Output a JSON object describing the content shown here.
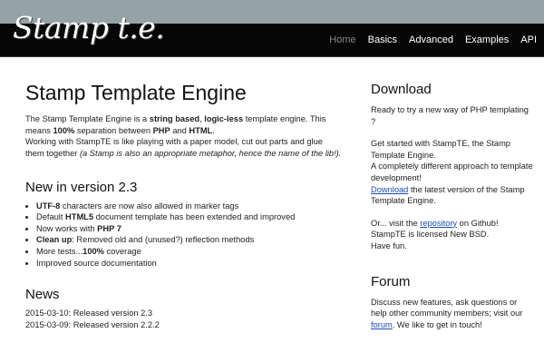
{
  "header": {
    "logo": "Stamp t.e.",
    "nav": [
      "Home",
      "Basics",
      "Advanced",
      "Examples",
      "API"
    ]
  },
  "main": {
    "title": "Stamp Template Engine",
    "intro": {
      "t1": "The Stamp Template Engine is a ",
      "b1": "string based",
      "t2": ", ",
      "b2": "logic-less",
      "t3": " template engine. This means ",
      "b3": "100%",
      "t4": " separation between ",
      "b4": "PHP",
      "t5": " and ",
      "b5": "HTML",
      "t6": ".",
      "t7": "Working with StampTE is like playing with a paper model, cut out parts and glue them together ",
      "i1": "(a Stamp is also an appropriate metaphor, hence the name of the lib!)."
    },
    "new": {
      "title": "New in version 2.3",
      "items": [
        {
          "pre": "",
          "bold": "UTF-8",
          "post": " characters are now also allowed in marker tags"
        },
        {
          "pre": "Default ",
          "bold": "HTML5",
          "post": " document template has been extended and improved"
        },
        {
          "pre": "Now works with ",
          "bold": "PHP 7",
          "post": ""
        },
        {
          "pre": "",
          "bold": "Clean up",
          "post": ": Removed old and (unused?) reflection methods"
        },
        {
          "pre": "More tests...",
          "bold": "100%",
          "post": " coverage"
        },
        {
          "pre": "Improved source documentation",
          "bold": "",
          "post": ""
        }
      ]
    },
    "news": {
      "title": "News",
      "items": [
        "2015-03-10: Released version 2.3",
        "2015-03-09: Released version 2.2.2"
      ]
    }
  },
  "sidebar": {
    "download": {
      "title": "Download",
      "p1": "Ready to try a new way of PHP templating ?",
      "p2": "Get started with StampTE, the Stamp Template Engine.",
      "p3": "A completely different approach to template development!",
      "p4_link": "Download",
      "p4_rest": " the latest version of the Stamp Template Engine.",
      "p5_a": "Or... visit the ",
      "p5_link": "repository",
      "p5_b": " on Github!",
      "p6": "StampTE is licensed New BSD.",
      "p7": "Have fun."
    },
    "forum": {
      "title": "Forum",
      "p_a": "Discuss new features, ask questions or help other community members; visit our ",
      "link": "forum",
      "p_b": ". We like to get in touch!"
    }
  }
}
